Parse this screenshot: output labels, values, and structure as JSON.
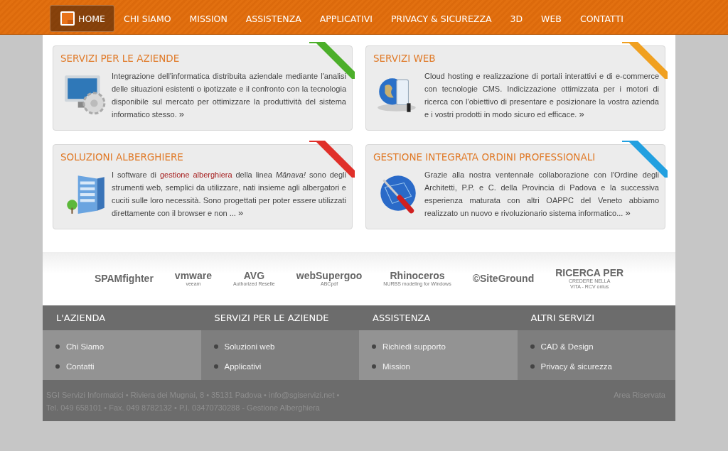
{
  "nav": {
    "items": [
      {
        "label": "HOME",
        "selected": true
      },
      {
        "label": "CHI SIAMO",
        "selected": false
      },
      {
        "label": "MISSION",
        "selected": false
      },
      {
        "label": "ASSISTENZA",
        "selected": false
      },
      {
        "label": "APPLICATIVI",
        "selected": false
      },
      {
        "label": "PRIVACY & SICUREZZA",
        "selected": false
      },
      {
        "label": "3D",
        "selected": false
      },
      {
        "label": "WEB",
        "selected": false
      },
      {
        "label": "CONTATTI",
        "selected": false
      }
    ]
  },
  "cards": [
    {
      "title": "SERVIZI PER LE AZIENDE",
      "color": "#4caf2a",
      "kind": "monitor",
      "body": [
        {
          "kind": "text",
          "text": "Integrazione dell'informatica distribuita aziendale mediante l'analisi delle situazioni esistenti o ipotizzate e il confronto con la tecnologia disponibile sul mercato per ottimizzare la produttività del sistema informatico stesso."
        }
      ],
      "more": "»"
    },
    {
      "title": "SERVIZI WEB",
      "color": "#f0a020",
      "kind": "globe",
      "body": [
        {
          "kind": "text",
          "text": "Cloud hosting e realizzazione di portali interattivi e di e-commerce con tecnologie CMS. Indicizzazione ottimizzata per i motori di ricerca con l'obiettivo di presentare e posizionare la vostra azienda e i vostri prodotti in modo sicuro ed efficace."
        }
      ],
      "more": "»"
    },
    {
      "title": "SOLUZIONI ALBERGHIERE",
      "color": "#e0302a",
      "kind": "building",
      "body": [
        {
          "kind": "text",
          "text": "I software di "
        },
        {
          "kind": "link",
          "text": "gestione alberghiera"
        },
        {
          "kind": "text",
          "text": " della linea *Mânava!* sono degli strumenti web, semplici da utilizzare, nati insieme agli albergatori e cuciti sulle loro necessità. Sono progettati per poter essere utilizzati direttamente con il browser e non ..."
        }
      ],
      "more": "»"
    },
    {
      "title": "GESTIONE INTEGRATA ORDINI PROFESSIONALI",
      "color": "#22a0e0",
      "kind": "tools",
      "body": [
        {
          "kind": "text",
          "text": "Grazie alla nostra ventennale collaborazione con l'Ordine degli Architetti, P.P. e C. della Provincia di Padova e la successiva esperienza maturata con altri OAPPC del Veneto abbiamo realizzato un nuovo e rivoluzionario sistema informatico..."
        }
      ],
      "more": "»"
    }
  ],
  "partners": [
    {
      "lines": [
        "SPAMfighter"
      ]
    },
    {
      "lines": [
        "vmware",
        "veeam"
      ]
    },
    {
      "lines": [
        "AVG",
        "Authorized Reselle"
      ]
    },
    {
      "lines": [
        "webSupergoo",
        "ABCpdf"
      ]
    },
    {
      "lines": [
        "Rhinoceros",
        "NURBS modeling for Windows"
      ]
    },
    {
      "lines": [
        "©SiteGround"
      ]
    },
    {
      "lines": [
        "RICERCA PER",
        "CREDERE NELLA",
        "VITA - RCV onlus"
      ]
    }
  ],
  "footer": {
    "columns": [
      {
        "title": "L'AZIENDA",
        "links": [
          "Chi Siamo",
          "Contatti"
        ]
      },
      {
        "title": "SERVIZI PER LE AZIENDE",
        "links": [
          "Soluzioni web",
          "Applicativi"
        ]
      },
      {
        "title": "ASSISTENZA",
        "links": [
          "Richiedi supporto",
          "Mission"
        ]
      },
      {
        "title": "ALTRI SERVIZI",
        "links": [
          "CAD & Design",
          "Privacy & sicurezza"
        ]
      }
    ],
    "address": [
      "SGI Servizi Informatici • Riviera dei Mugnai, 8 • 35131 Padova • info@sgiservizi.net •",
      "Tel. 049 658101 • Fax. 049 8782132 • P.I. 03470730288 - Gestione Alberghiera"
    ],
    "reserved": "Area Riservata"
  }
}
